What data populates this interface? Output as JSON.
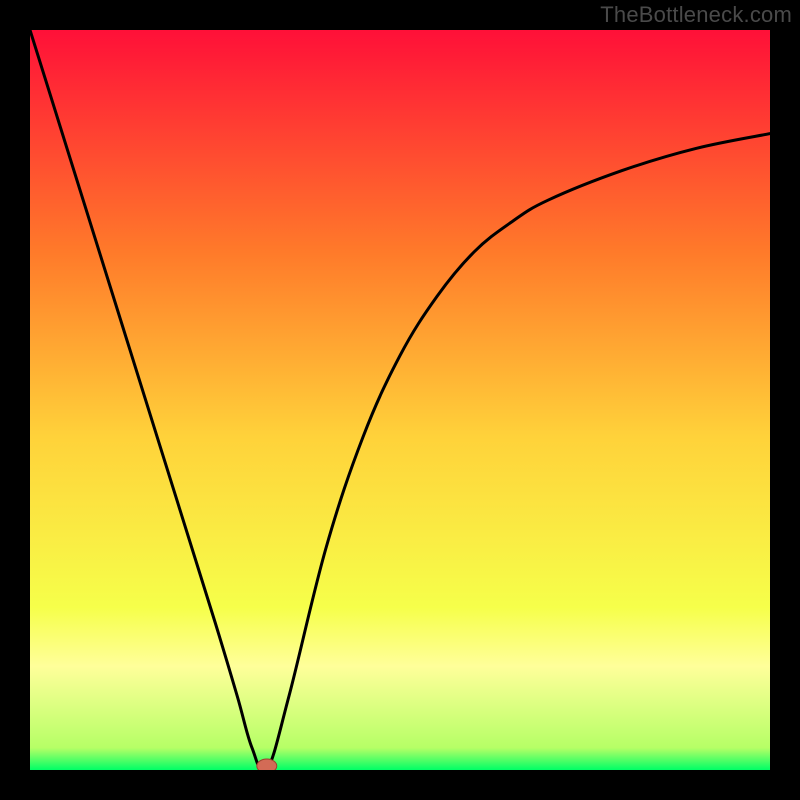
{
  "watermark": "TheBottleneck.com",
  "colors": {
    "frame": "#000000",
    "gradient_top": "#ff1038",
    "gradient_mid_upper": "#ff7a2a",
    "gradient_mid": "#ffd23a",
    "gradient_mid_lower": "#f6ff4a",
    "gradient_yellowcream": "#ffff9a",
    "gradient_bottom": "#00ff66",
    "curve": "#000000",
    "marker_fill": "#d36b56",
    "marker_stroke": "#9e3f2d"
  },
  "chart_data": {
    "type": "line",
    "title": "",
    "xlabel": "",
    "ylabel": "",
    "xlim": [
      0,
      100
    ],
    "ylim": [
      0,
      100
    ],
    "grid": false,
    "legend": false,
    "series": [
      {
        "name": "bottleneck-curve",
        "x": [
          0,
          5,
          10,
          15,
          20,
          25,
          28,
          30,
          32,
          35,
          40,
          45,
          50,
          55,
          60,
          65,
          70,
          80,
          90,
          100
        ],
        "y": [
          100,
          84,
          68,
          52,
          36,
          20,
          10,
          3,
          0,
          10,
          30,
          45,
          56,
          64,
          70,
          74,
          77,
          81,
          84,
          86
        ]
      }
    ],
    "marker": {
      "x": 32,
      "y": 0
    },
    "gradient_stops": [
      {
        "pos": 0.0,
        "color": "#ff1038"
      },
      {
        "pos": 0.3,
        "color": "#ff7a2a"
      },
      {
        "pos": 0.55,
        "color": "#ffd23a"
      },
      {
        "pos": 0.78,
        "color": "#f6ff4a"
      },
      {
        "pos": 0.86,
        "color": "#ffff9a"
      },
      {
        "pos": 0.97,
        "color": "#b6ff66"
      },
      {
        "pos": 1.0,
        "color": "#00ff66"
      }
    ]
  }
}
